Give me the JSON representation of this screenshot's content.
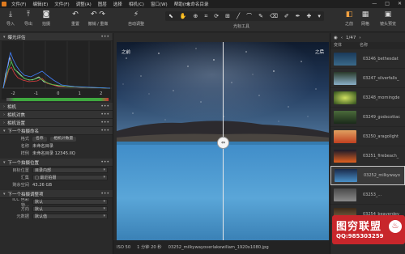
{
  "menubar": {
    "items": [
      "文件(F)",
      "编辑(E)",
      "文件(F)",
      "调整(A)",
      "图层",
      "选择",
      "相机(C)",
      "窗口(W)",
      "帮助(H)"
    ],
    "window_title": "未命名目录",
    "controls": [
      "—",
      "□",
      "✕"
    ]
  },
  "toolbar": {
    "import": "导入",
    "export": "导出",
    "capture": "拍摄",
    "rotate": "重置",
    "undo": "撤销 / 重做",
    "auto_adjust": "自动调整",
    "tools_label": "光标工具",
    "before_after": "之前",
    "grid": "网格",
    "browse": "镜头预览"
  },
  "left_panel": {
    "exposure_eval": "曝光评估",
    "hist_scale": [
      "-2",
      "-1",
      "0",
      "1",
      "2"
    ],
    "camera": "相机",
    "camera_focus": "相机对焦",
    "camera_settings": "相机设置",
    "next_naming": "下一个拍摄命名",
    "format_label": "格式",
    "format_pills": [
      "名称",
      "相机计数量"
    ],
    "name_label": "名称",
    "name_value": "未命名目录",
    "sample_label": "样例",
    "sample_value": "未命名目录 12345.IIQ",
    "next_location": "下一个拍摄位置",
    "target_label": "目标位置",
    "target_value": "目录内部",
    "collection_label": "汇集",
    "collection_value": "□ 最近拍摄",
    "remaining_label": "剩余空间",
    "remaining_value": "43.26 GB",
    "next_adjust": "下一个拍摄调整项",
    "icc_label": "ICC 色彩特...",
    "icc_value": "默认",
    "orient_label": "方向",
    "orient_value": "默认",
    "meta_label": "元数据",
    "meta_value": "默认值"
  },
  "viewer": {
    "before_label": "之前",
    "after_label": "之后"
  },
  "statusbar": {
    "iso": "ISO 50",
    "shutter": "1 分钟 20 秒",
    "filename": "03252_milkywayoverlakewillam_1920x1080.jpg"
  },
  "right_panel": {
    "counter": "1/47",
    "col_left": "变体",
    "col_right": "名称",
    "thumbs": [
      {
        "name": "03246_bethesdat"
      },
      {
        "name": "03247_silverfalls_"
      },
      {
        "name": "03248_morningde"
      },
      {
        "name": "03249_godscottac"
      },
      {
        "name": "03250_aragolight"
      },
      {
        "name": "03251_firebeach_"
      },
      {
        "name": "03252_milkywayo"
      },
      {
        "name": "03253_..."
      },
      {
        "name": "03254_beaverdev"
      }
    ]
  },
  "watermark": {
    "main": "图穷联盟",
    "sub": "QQ:985303259"
  },
  "colors": {
    "accent": "#f0a040",
    "panel": "#2a2a2a",
    "watermark_red": "#c8262b"
  }
}
